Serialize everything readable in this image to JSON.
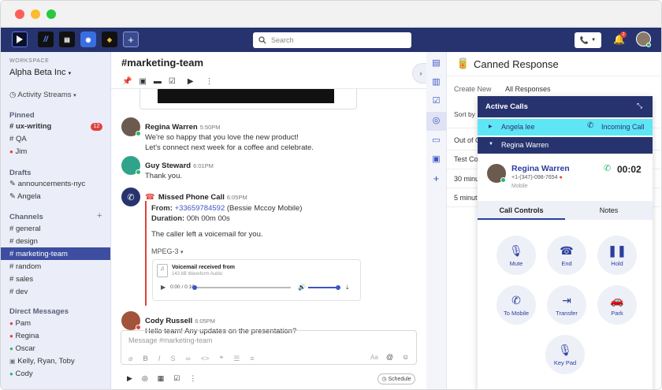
{
  "topbar": {
    "search_placeholder": "Search",
    "notif_count": "2",
    "app_icons": [
      "ringcentral-app",
      "app-2",
      "app-3",
      "app-4",
      "app-5"
    ]
  },
  "sidebar": {
    "workspace_label": "WORKSPACE",
    "workspace_name": "Alpha Beta Inc",
    "activity_streams": "Activity Streams",
    "pinned_header": "Pinned",
    "pinned": [
      {
        "label": "ux-writing",
        "prefix": "#",
        "badge": "12",
        "bold": true
      },
      {
        "label": "QA",
        "prefix": "#"
      },
      {
        "label": "Jim",
        "prefix": "dot",
        "color": "#e0423c"
      }
    ],
    "drafts_header": "Drafts",
    "drafts": [
      "announcements-nyc",
      "Angela"
    ],
    "channels_header": "Channels",
    "channels": [
      "general",
      "design",
      "marketing-team",
      "random",
      "sales",
      "dev"
    ],
    "selected_channel": "marketing-team",
    "dm_header": "Direct Messages",
    "dms": [
      {
        "label": "Pam",
        "color": "#e0423c"
      },
      {
        "label": "Regina",
        "color": "#e0423c"
      },
      {
        "label": "Oscar",
        "color": "#2fb36b"
      },
      {
        "label": "Kelly, Ryan, Toby",
        "color": "#888"
      },
      {
        "label": "Cody",
        "color": "#2fb36b"
      }
    ]
  },
  "chat": {
    "title": "#marketing-team",
    "messages": [
      {
        "name": "Regina Warren",
        "time": "5:50PM",
        "lines": [
          "We're so happy that you love the new product!",
          "Let's connect next week for a coffee and celebrate."
        ]
      },
      {
        "name": "Guy Steward",
        "time": "6:01PM",
        "lines": [
          "Thank you."
        ]
      },
      {
        "name": "Missed Phone Call",
        "time": "6:05PM"
      },
      {
        "name": "Cody Russell",
        "time": "6:05PM",
        "lines": [
          "Hello team! Any updates on the presentation?"
        ]
      }
    ],
    "call": {
      "from_label": "From:",
      "from_number": "+33659784592",
      "from_name": "(Bessie Mccoy Mobile)",
      "duration_label": "Duration:",
      "duration": "00h 00m 00s",
      "voicemail_note": "The caller left a voicemail for you.",
      "format": "MPEG-3",
      "vm_title": "Voicemail received from",
      "vm_sub": "143 kB Waveform Audio",
      "vm_time": "0:00 / 0:10"
    },
    "composer_placeholder": "Message #marketing-team",
    "schedule_label": "Schedule"
  },
  "canned": {
    "title": "Canned Response",
    "tabs": [
      "Create New",
      "All Responses"
    ],
    "sort_label": "Sort by",
    "rows": [
      "Out of O",
      "Test Con",
      "30 minu",
      "5 minut"
    ]
  },
  "active_calls": {
    "title": "Active Calls",
    "calls": [
      {
        "name": "Angela lee",
        "status": "Incoming Call"
      },
      {
        "name": "Regina Warren"
      }
    ],
    "caller_name": "Regina Warren",
    "caller_number": "+1-(347)-098-7654",
    "caller_type": "Mobile",
    "timer": "00:02",
    "tabs": [
      "Call Controls",
      "Notes"
    ],
    "controls": [
      {
        "label": "Mute",
        "icon": "mic-off-icon"
      },
      {
        "label": "End",
        "icon": "hangup-icon"
      },
      {
        "label": "Hold",
        "icon": "pause-icon"
      },
      {
        "label": "To Mobile",
        "icon": "phone-forward-icon"
      },
      {
        "label": "Transfer",
        "icon": "transfer-icon"
      },
      {
        "label": "Park",
        "icon": "car-icon"
      },
      {
        "label": "Key Pad",
        "icon": "keypad-icon"
      }
    ]
  },
  "colors": {
    "topbar": "#27336e",
    "selected": "#3d4ea0",
    "accent": "#3d55c4",
    "incoming": "#5fe6f5",
    "badge": "#e0423c"
  }
}
